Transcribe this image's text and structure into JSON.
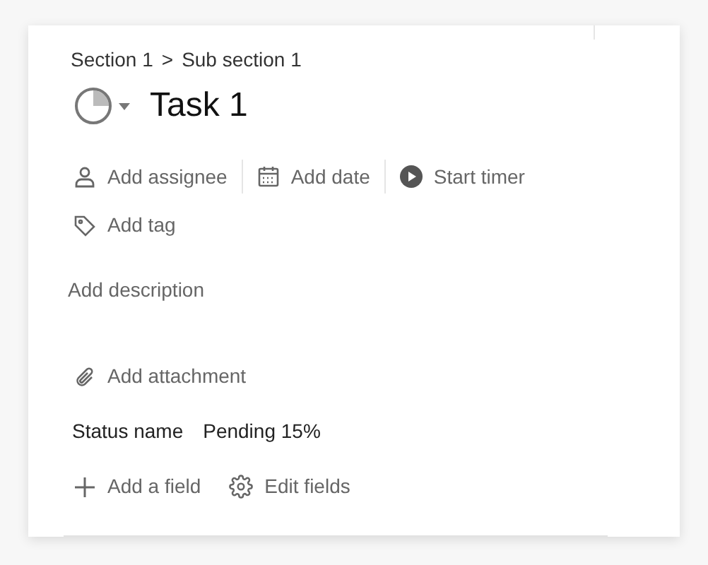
{
  "breadcrumb": {
    "section": "Section 1",
    "separator": ">",
    "subsection": "Sub section 1"
  },
  "task": {
    "title": "Task 1"
  },
  "actions": [
    {
      "kind": "assignee",
      "label": "Add assignee"
    },
    {
      "kind": "date",
      "label": "Add date"
    },
    {
      "kind": "timer",
      "label": "Start timer"
    }
  ],
  "tag": {
    "label": "Add tag"
  },
  "description": {
    "placeholder": "Add description"
  },
  "attachment": {
    "label": "Add attachment"
  },
  "fields": [
    {
      "name": "Status name",
      "value": "Pending 15%"
    }
  ],
  "field_actions": [
    {
      "kind": "add",
      "label": "Add a field"
    },
    {
      "kind": "edit",
      "label": "Edit fields"
    }
  ]
}
